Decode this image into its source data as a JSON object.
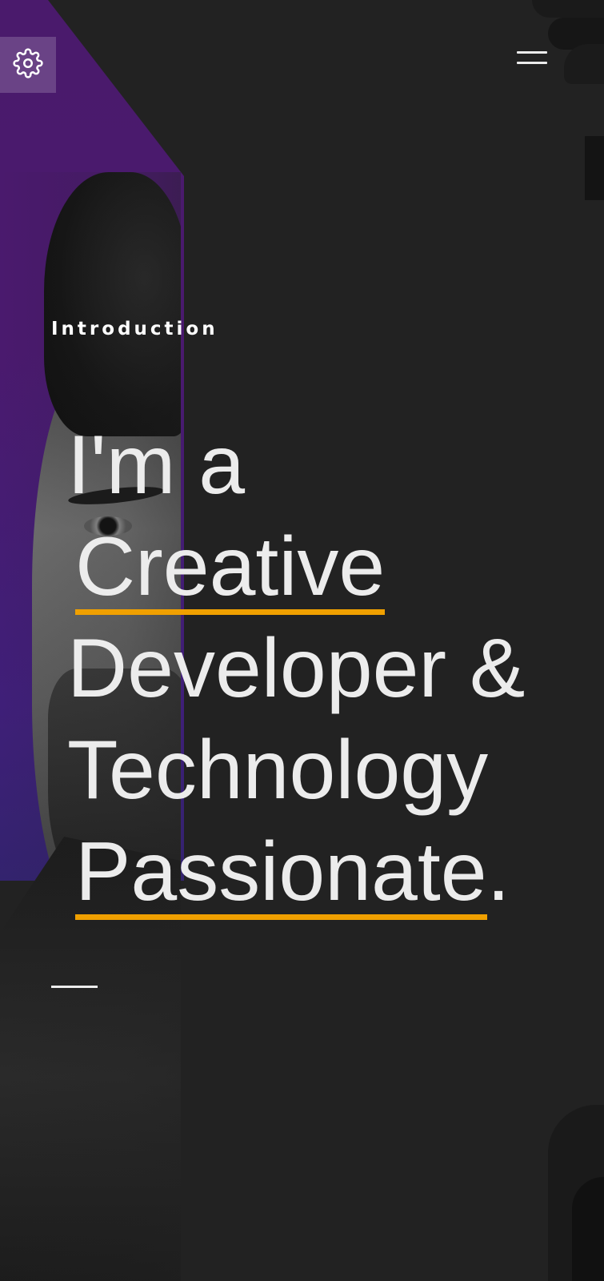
{
  "header": {
    "settings_icon": "gear-icon",
    "menu_icon": "hamburger-menu-icon"
  },
  "hero": {
    "eyebrow": "Introduction",
    "line1": "I'm a",
    "highlight1": "Creative",
    "line3": "Developer &",
    "line4": "Technology",
    "highlight2": "Passionate",
    "period": "."
  },
  "colors": {
    "background": "#222222",
    "accent_underline": "#f0a000",
    "purple_panel": "#4a1a6c",
    "text": "#ececec"
  }
}
